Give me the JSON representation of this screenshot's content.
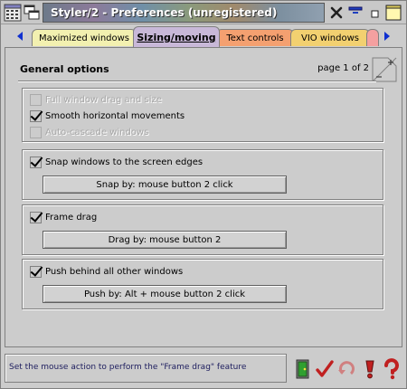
{
  "window": {
    "title": "Styler/2 - Preferences (unregistered)"
  },
  "tabs": [
    {
      "label": "Maximized windows",
      "active": false,
      "color": "#f2f0b0"
    },
    {
      "label": "Sizing/moving",
      "active": true,
      "color": "#c8b8d8"
    },
    {
      "label": "Text controls",
      "active": false,
      "color": "#f4a070"
    },
    {
      "label": "VIO windows",
      "active": false,
      "color": "#f2d070"
    },
    {
      "label": "",
      "active": false,
      "color": "#f4a0a0"
    }
  ],
  "page": {
    "title": "General options",
    "page_indicator": "page 1 of 2"
  },
  "group1": {
    "options": [
      {
        "label": "Full window drag and size",
        "checked": false,
        "enabled": false
      },
      {
        "label": "Smooth horizontal movements",
        "checked": true,
        "enabled": true
      },
      {
        "label": "Auto-cascade windows",
        "checked": false,
        "enabled": false
      }
    ]
  },
  "group2": {
    "option": {
      "label": "Snap windows to the screen edges",
      "checked": true
    },
    "button": "Snap by: mouse button 2 click"
  },
  "group3": {
    "option": {
      "label": "Frame drag",
      "checked": true
    },
    "button": "Drag by: mouse button 2"
  },
  "group4": {
    "option": {
      "label": "Push behind all other windows",
      "checked": true
    },
    "button": "Push by: Alt + mouse button 2 click"
  },
  "status": {
    "text": "Set the mouse action to perform the \"Frame drag\" feature"
  },
  "toolbar": {
    "icons": [
      "exit-icon",
      "apply-checkmark-icon",
      "undo-icon",
      "default-icon",
      "help-icon"
    ]
  }
}
